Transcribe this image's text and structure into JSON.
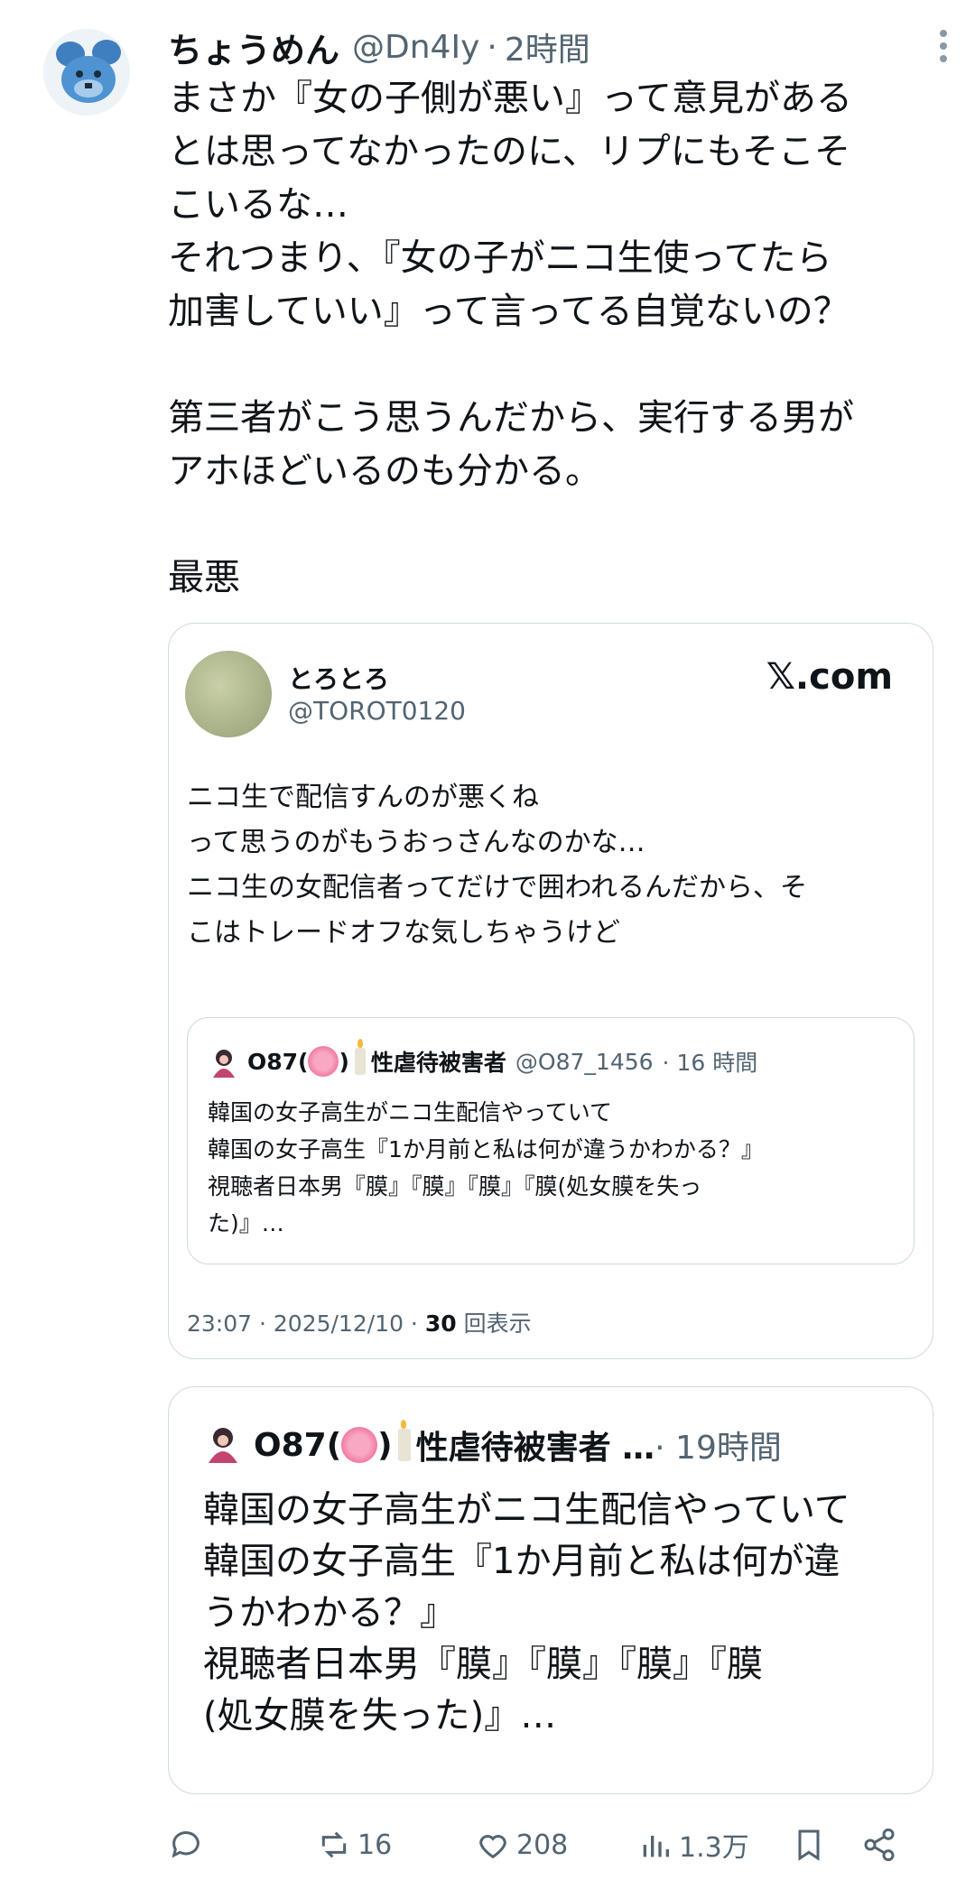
{
  "tweet": {
    "name": "ちょうめん",
    "handle": "@Dn4Iy",
    "separator": "·",
    "time": "2時間",
    "text": "まさか『女の子側が悪い』って意見がある\nとは思ってなかったのに、リプにもそこそ\nこいるな…\nそれつまり、『女の子がニコ生使ってたら\n加害していい』って言ってる自覚ないの？\n\n第三者がこう思うんだから、実行する男が\nアホほどいるのも分かる。\n\n最悪"
  },
  "embed_card": {
    "name": "とろとろ",
    "handle": "@TOROT0120",
    "brand": "𝕏.com",
    "text": "ニコ生で配信すんのが悪くね\nって思うのがもうおっさんなのかな…\nニコ生の女配信者ってだけで囲われるんだから、そ\nこはトレードオフな気しちゃうけど",
    "quote": {
      "name_prefix": "O87(",
      "name_suffix": ")",
      "name_rest": "性虐待被害者",
      "handle": "@O87_1456",
      "time": "· 16 時間",
      "text": "韓国の女子高生がニコ生配信やっていて\n韓国の女子高生『1か月前と私は何が違うかわかる？』\n視聴者日本男『膜』『膜』『膜』『膜(処女膜を失っ\nた)』…"
    },
    "meta_time": "23:07 · 2025/12/10 · ",
    "meta_views": "30",
    "meta_views_label": " 回表示"
  },
  "quote_card": {
    "name_prefix": "O87(",
    "name_suffix": ")",
    "name_rest": "性虐待被害者 …",
    "time": " · 19時間",
    "text": "韓国の女子高生がニコ生配信やっていて\n韓国の女子高生『1か月前と私は何が違\nうかわかる？』\n視聴者日本男『膜』『膜』『膜』『膜\n(処女膜を失った)』…"
  },
  "actions": {
    "reply": "",
    "retweets": "16",
    "likes": "208",
    "views": "1.3万"
  }
}
